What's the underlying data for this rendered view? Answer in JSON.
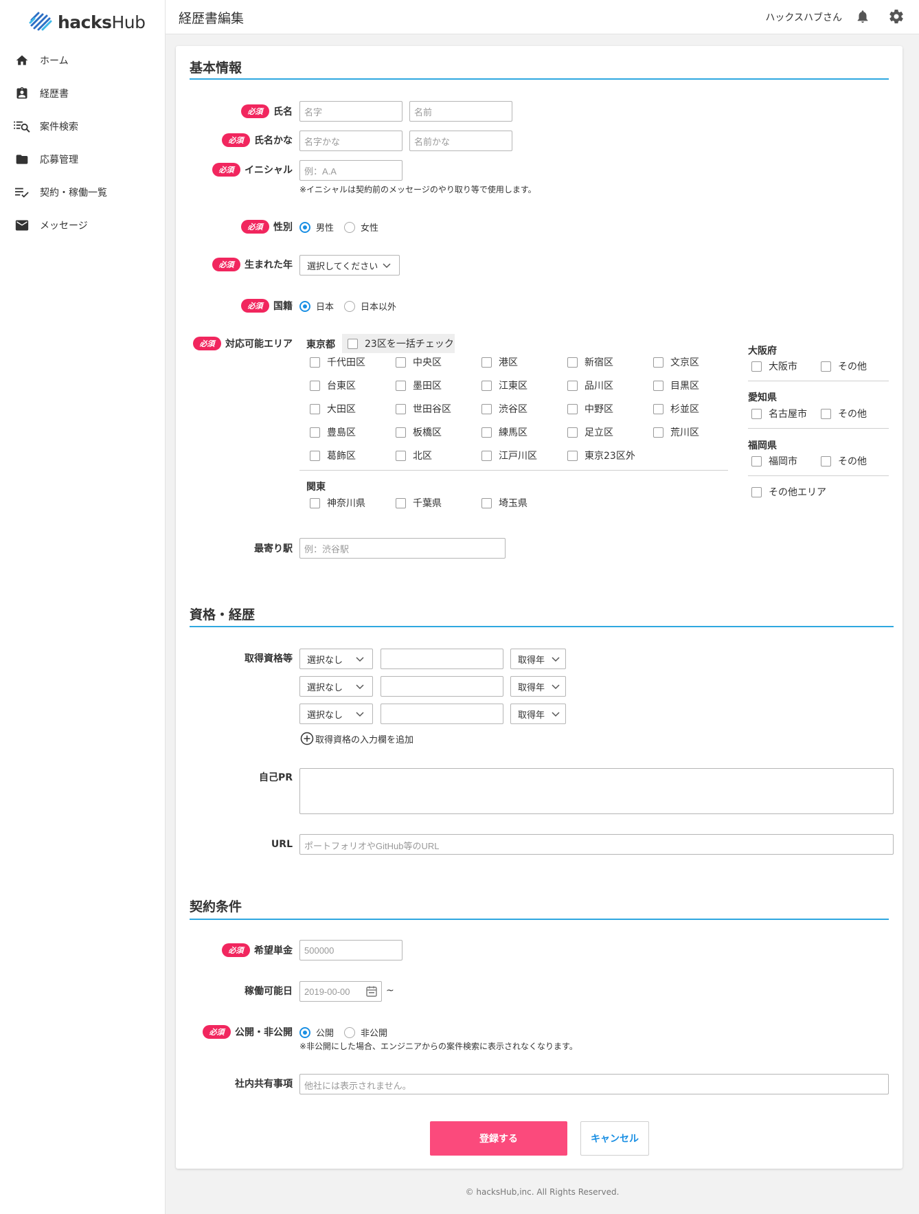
{
  "app": {
    "logo": {
      "bold": "hacks",
      "light": "Hub"
    }
  },
  "sidebar": {
    "items": [
      {
        "label": "ホーム",
        "icon": "home-icon"
      },
      {
        "label": "経歴書",
        "icon": "clipboard-icon"
      },
      {
        "label": "案件検索",
        "icon": "list-search-icon"
      },
      {
        "label": "応募管理",
        "icon": "folder-icon"
      },
      {
        "label": "契約・稼働一覧",
        "icon": "checklist-icon"
      },
      {
        "label": "メッセージ",
        "icon": "mail-icon"
      }
    ]
  },
  "header": {
    "title": "経歴書編集",
    "user": "ハックスハブさん"
  },
  "required_tag": "必須",
  "basic": {
    "title": "基本情報",
    "name": {
      "label": "氏名",
      "last_ph": "名字",
      "first_ph": "名前"
    },
    "kana": {
      "label": "氏名かな",
      "last_ph": "名字かな",
      "first_ph": "名前かな"
    },
    "initial": {
      "label": "イニシャル",
      "ph": "例：A.A",
      "note": "※イニシャルは契約前のメッセージのやり取り等で使用します。"
    },
    "gender": {
      "label": "性別",
      "options": [
        "男性",
        "女性"
      ],
      "selected": "男性"
    },
    "birth": {
      "label": "生まれた年",
      "value": "選択してください"
    },
    "nationality": {
      "label": "国籍",
      "options": [
        "日本",
        "日本以外"
      ],
      "selected": "日本"
    },
    "area": {
      "label": "対応可能エリア",
      "tokyo": "東京都",
      "check_all": "23区を一括チェック",
      "wards": [
        "千代田区",
        "中央区",
        "港区",
        "新宿区",
        "文京区",
        "台東区",
        "墨田区",
        "江東区",
        "品川区",
        "目黒区",
        "大田区",
        "世田谷区",
        "渋谷区",
        "中野区",
        "杉並区",
        "豊島区",
        "板橋区",
        "練馬区",
        "足立区",
        "荒川区",
        "葛飾区",
        "北区",
        "江戸川区",
        "東京23区外"
      ],
      "kanto": "関東",
      "kanto_items": [
        "神奈川県",
        "千葉県",
        "埼玉県"
      ],
      "osaka": "大阪府",
      "osaka_items": [
        "大阪市",
        "その他"
      ],
      "aichi": "愛知県",
      "aichi_items": [
        "名古屋市",
        "その他"
      ],
      "fukuoka": "福岡県",
      "fukuoka_items": [
        "福岡市",
        "その他"
      ],
      "other": "その他エリア"
    },
    "station": {
      "label": "最寄り駅",
      "ph": "例：渋谷駅"
    }
  },
  "career": {
    "title": "資格・経歴",
    "cert_label": "取得資格等",
    "cert_select": "選択なし",
    "year_select": "取得年",
    "add": "取得資格の入力欄を追加",
    "pr_label": "自己PR",
    "url_label": "URL",
    "url_ph": "ポートフォリオやGitHub等のURL"
  },
  "contract": {
    "title": "契約条件",
    "price": {
      "label": "希望単金",
      "value": "500000"
    },
    "start": {
      "label": "稼働可能日",
      "value": "2019-00-00",
      "tilde": "~"
    },
    "publish": {
      "label": "公開・非公開",
      "options": [
        "公開",
        "非公開"
      ],
      "selected": "公開",
      "note": "※非公開にした場合、エンジニアからの案件検索に表示されなくなります。"
    },
    "internal": {
      "label": "社内共有事項",
      "ph": "他社には表示されません。"
    }
  },
  "buttons": {
    "submit": "登録する",
    "cancel": "キャンセル"
  },
  "footer": "© hacksHub,inc. All Rights Reserved.",
  "colors": {
    "accent": "#2ea7e0",
    "required": "#f1265e",
    "submit": "#fb4a7c",
    "radio": "#1a8fe3"
  }
}
